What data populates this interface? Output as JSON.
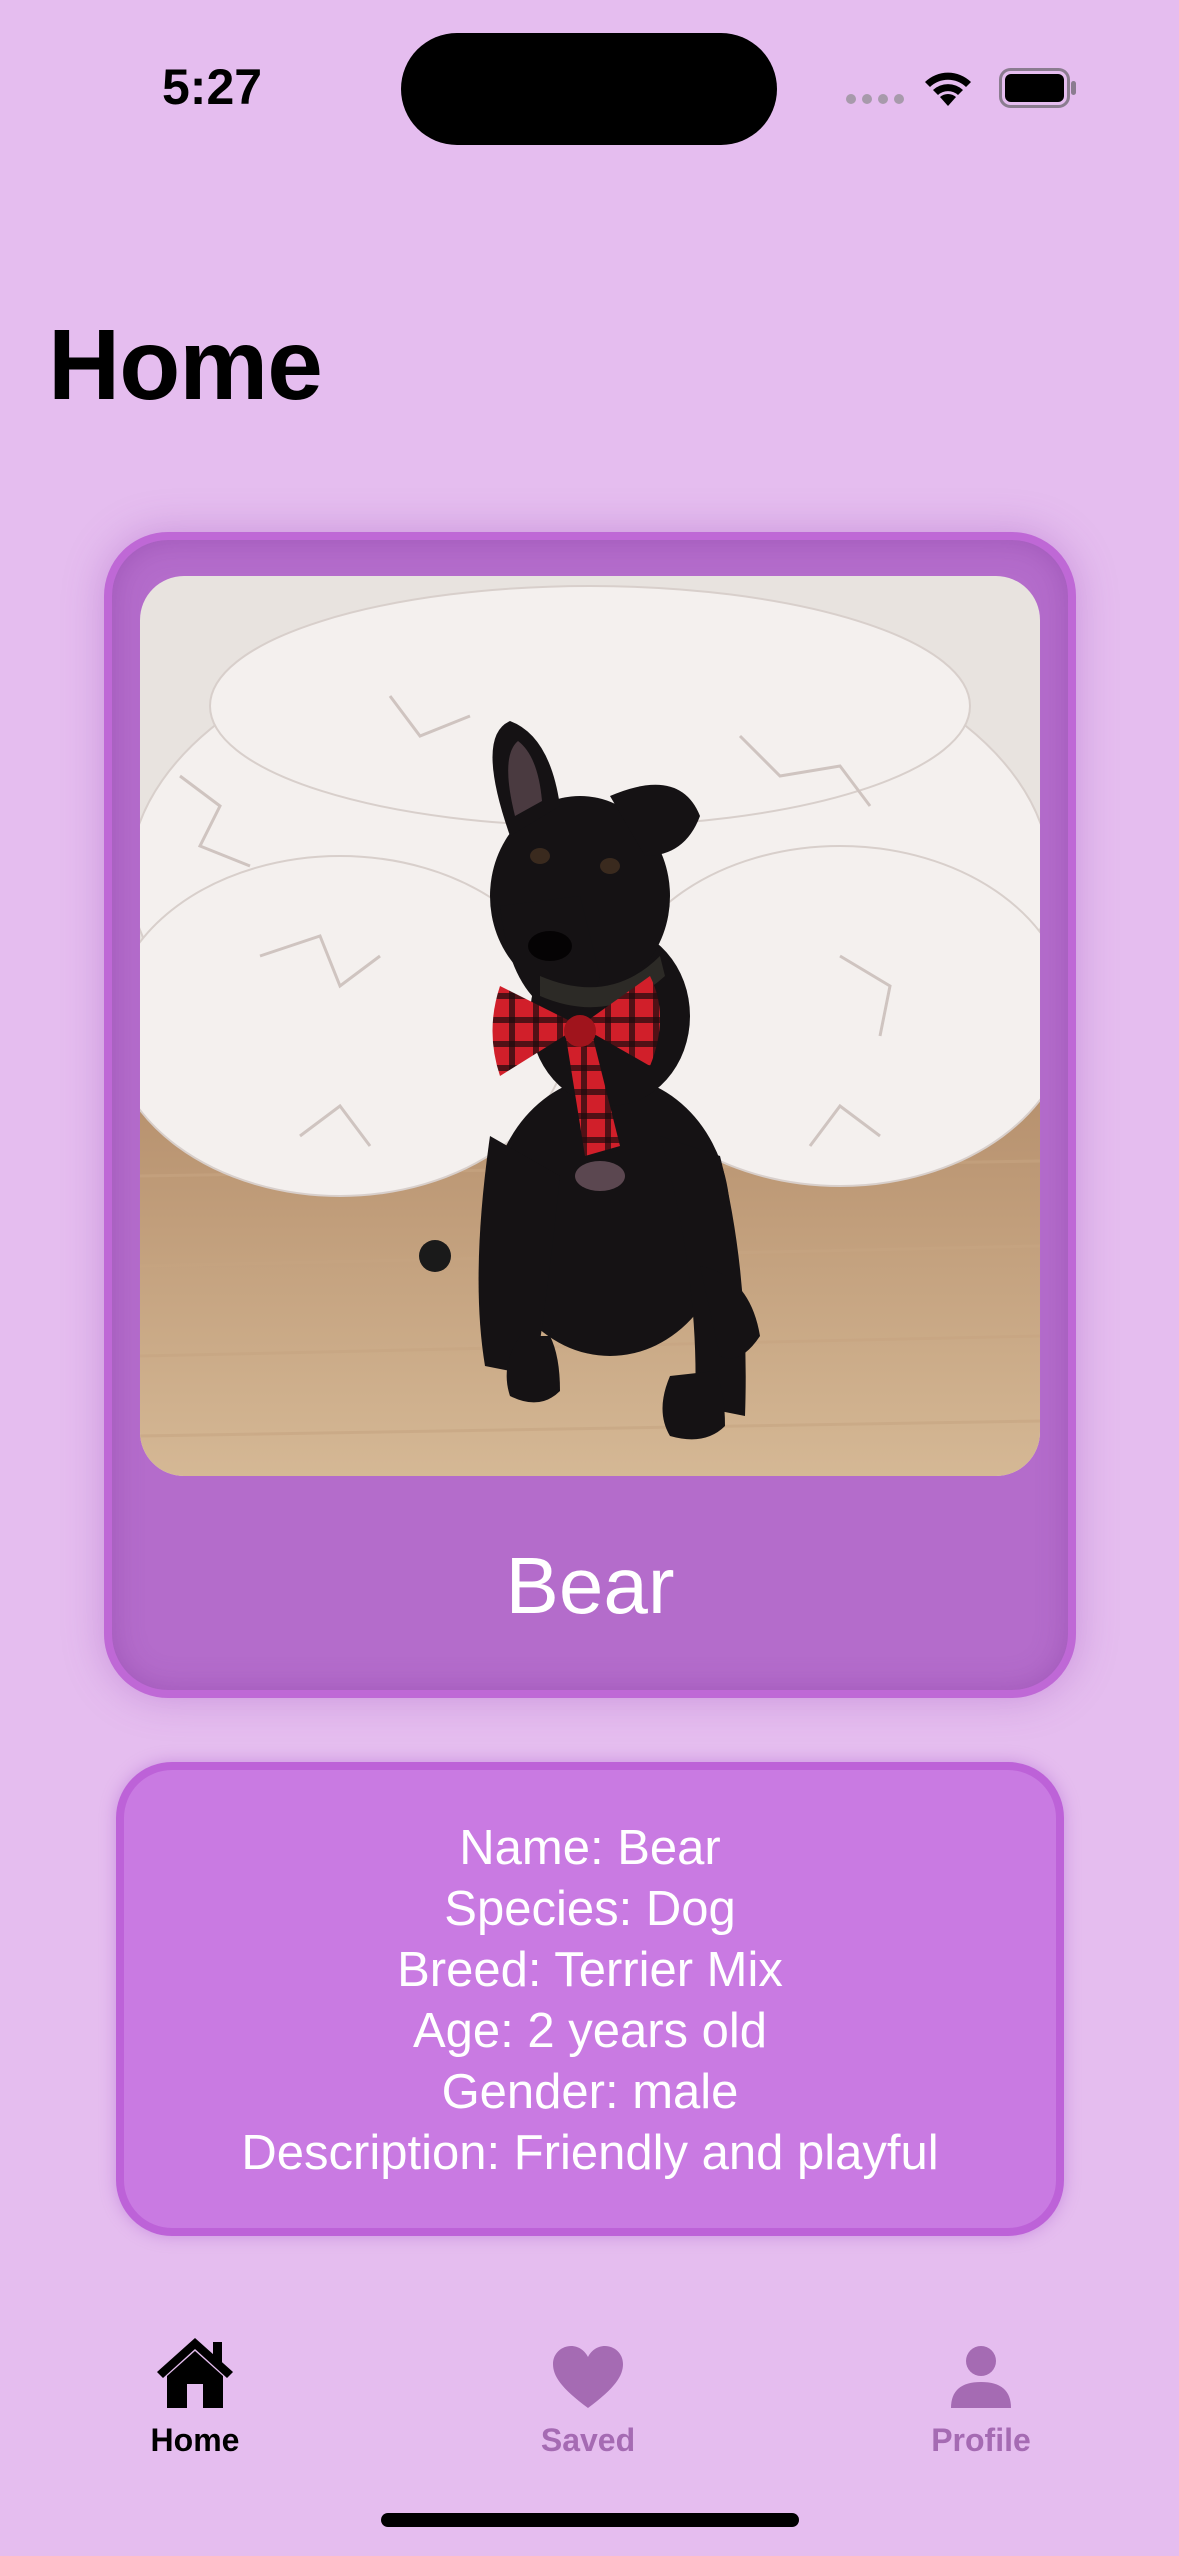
{
  "status_bar": {
    "time": "5:27",
    "icons": [
      "cellular-signal-icon",
      "wifi-icon",
      "battery-icon"
    ]
  },
  "page": {
    "title": "Home"
  },
  "pet_card": {
    "image_description": "black puppy with red plaid bow tie",
    "name": "Bear"
  },
  "pet_info": {
    "name_line": "Name: Bear",
    "species_line": "Species: Dog",
    "breed_line": "Breed: Terrier Mix",
    "age_line": "Age: 2 years old",
    "gender_line": "Gender: male",
    "description_line": "Description: Friendly and playful"
  },
  "tab_bar": {
    "tabs": [
      {
        "label": "Home",
        "icon": "house-icon",
        "selected": true
      },
      {
        "label": "Saved",
        "icon": "heart-icon",
        "selected": false
      },
      {
        "label": "Profile",
        "icon": "person-icon",
        "selected": false
      }
    ]
  },
  "colors": {
    "background": "#e5bdef",
    "card": "#b46ccb",
    "card_border": "#bf68d6",
    "info_box": "#c97ae2",
    "tab_inactive": "#a56bb3"
  }
}
